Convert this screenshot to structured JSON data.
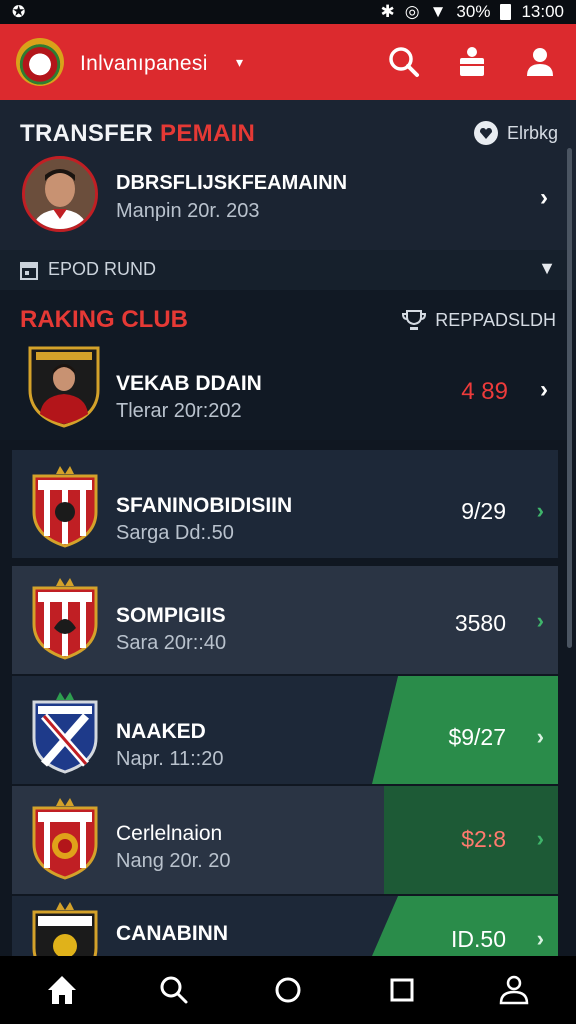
{
  "status_bar": {
    "left_icon": "app-notification-icon",
    "battery": "30%",
    "time": "13:00"
  },
  "header": {
    "title": "Inlvanıpanesi",
    "caret": "▾"
  },
  "transfer": {
    "title_white": "TRANSFER ",
    "title_red": "PEMAIN",
    "action_label": "Elrbkg",
    "player": {
      "name": "DBRSFLIJSKFEAMAINN",
      "subtitle": "Manpin 20r. 203"
    }
  },
  "filter": {
    "label": "EPOD RUND",
    "caret": "▼"
  },
  "ranking": {
    "title": "RAKING CLUB",
    "action_label": "REPPADSLDH",
    "top": {
      "name": "VEKAB DDAIN",
      "subtitle": "Tlerar 20r:202",
      "score": "4 89"
    }
  },
  "clubs": [
    {
      "name": "SFANINOBIDISIIN",
      "subtitle": "Sarga Dd:.50",
      "score": "9/29"
    },
    {
      "name": "SOMPIGIIS",
      "subtitle": "Sara 20r::40",
      "score": "3580"
    },
    {
      "name": "NAAKED",
      "subtitle": "Napr. 11::20",
      "score": "$9/27"
    },
    {
      "name": "Cerlelnaion",
      "subtitle": "Nang 20r. 20",
      "score": "$2:8"
    },
    {
      "name": "CANABINN",
      "subtitle": "",
      "score": "ID.50"
    }
  ],
  "colors": {
    "header_red": "#dc2a2e",
    "accent_red": "#e53935",
    "positive_green": "#2a8c4a",
    "dark_green": "#1d5a36",
    "bg": "#101721"
  }
}
